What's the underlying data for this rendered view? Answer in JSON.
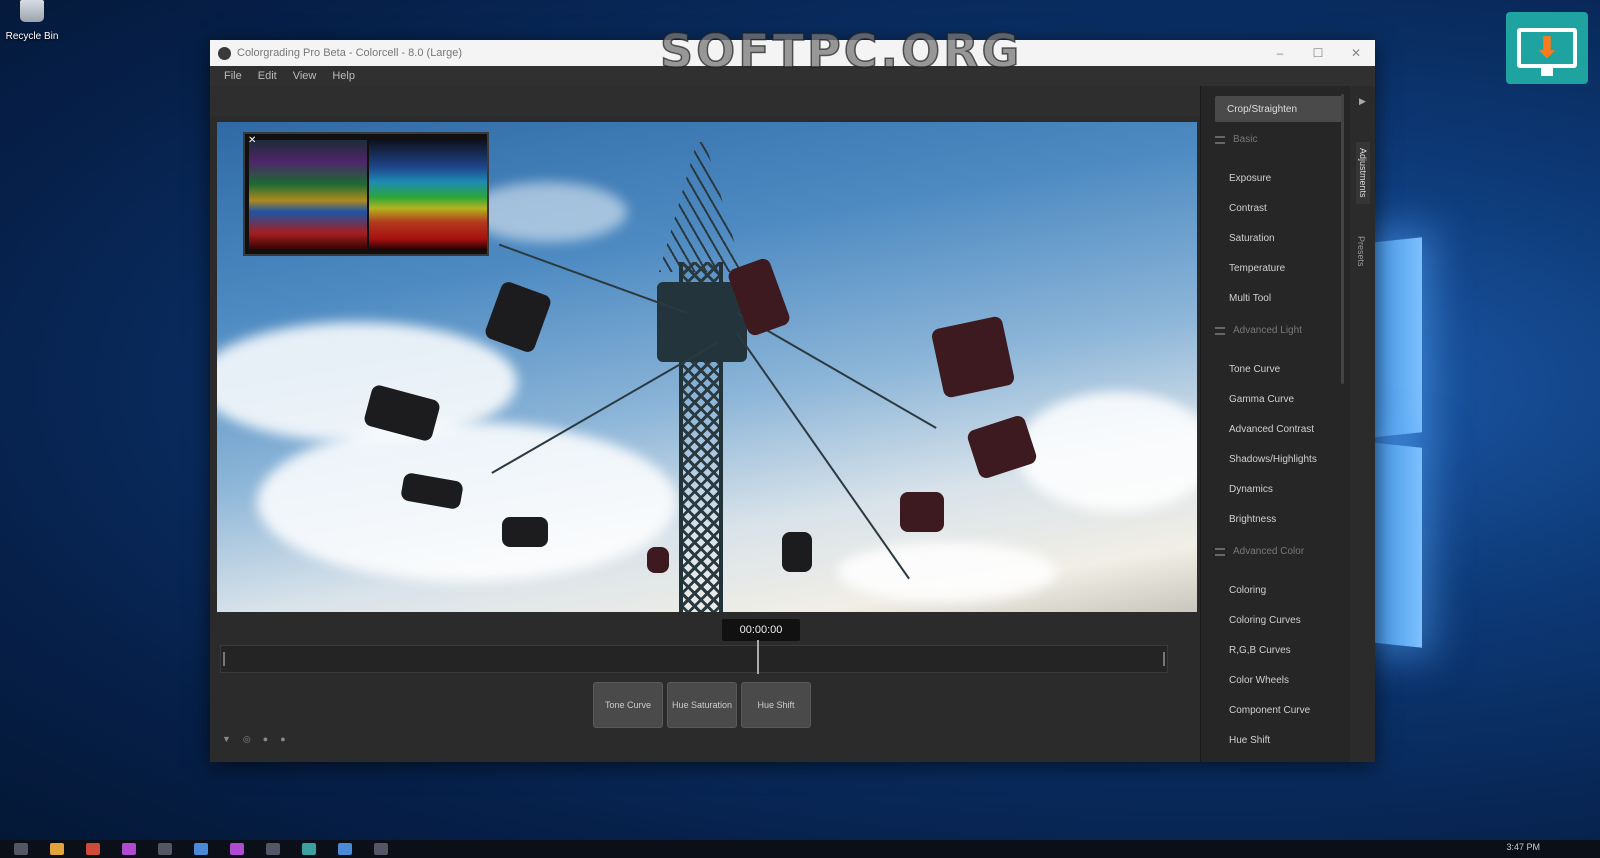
{
  "desktop": {
    "recycle_bin_label": "Recycle Bin",
    "watermark": "SOFTPC.ORG"
  },
  "window": {
    "title": "Colorgrading Pro Beta - Colorcell - 8.0 (Large)",
    "controls": [
      "–",
      "☐",
      "✕"
    ]
  },
  "menu": [
    "File",
    "Edit",
    "View",
    "Help"
  ],
  "viewer": {
    "scopes_close": "✕",
    "timecode": "00:00:00"
  },
  "curve_buttons": [
    "Tone Curve",
    "Hue Saturation",
    "Hue Shift"
  ],
  "bottom_tools": [
    "▼",
    "◎",
    "●",
    "●"
  ],
  "side_panel": {
    "crop_button": "Crop/Straighten",
    "groups": [
      {
        "label": "Basic",
        "items": [
          "Exposure",
          "Contrast",
          "Saturation",
          "Temperature",
          "Multi Tool"
        ]
      },
      {
        "label": "Advanced Light",
        "items": [
          "Tone Curve",
          "Gamma Curve",
          "Advanced Contrast",
          "Shadows/Highlights",
          "Dynamics",
          "Brightness"
        ]
      },
      {
        "label": "Advanced Color",
        "items": [
          "Coloring",
          "Coloring Curves",
          "R,G,B Curves",
          "Color Wheels",
          "Component Curve",
          "Hue Shift"
        ]
      }
    ],
    "vertical_tabs": [
      "Adjustments",
      "Presets"
    ],
    "collapse_arrow": "▶"
  },
  "taskbar": {
    "clock": "3:47 PM"
  }
}
